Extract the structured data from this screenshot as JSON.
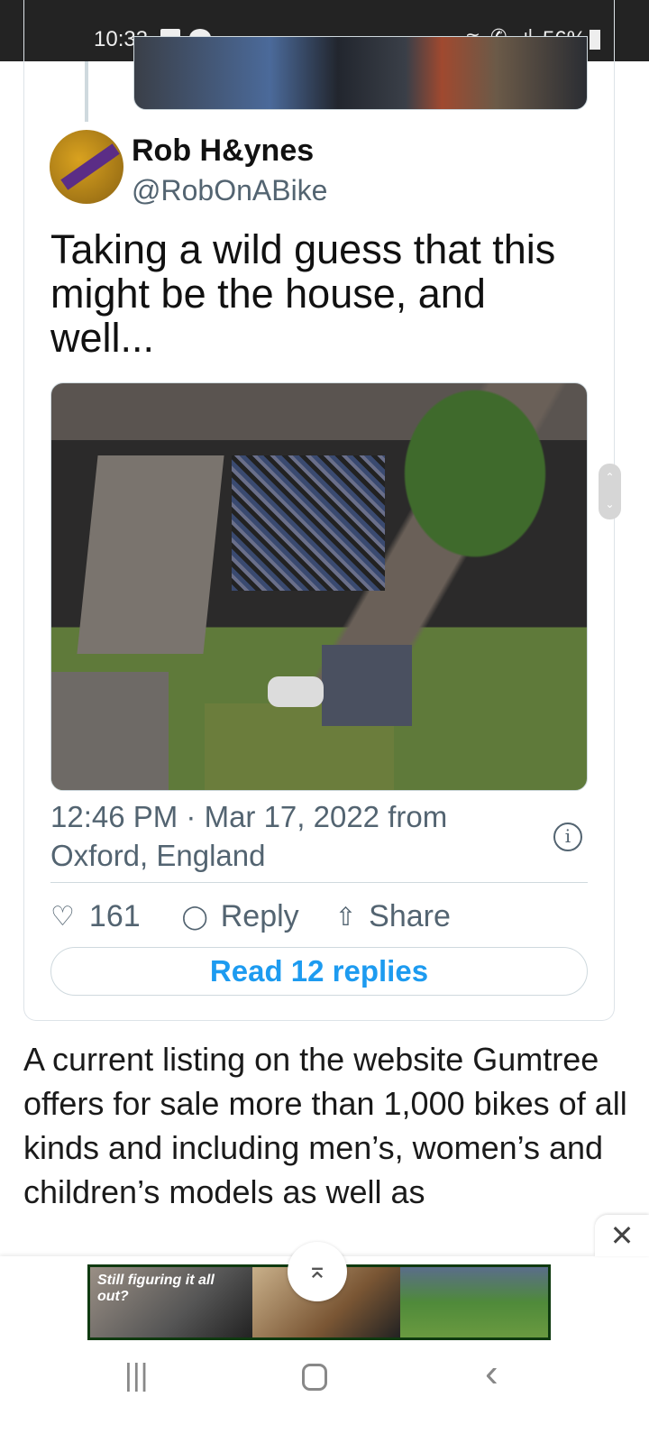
{
  "status_bar": {
    "time": "10:33",
    "battery": "56%",
    "icons": [
      "gallery-icon",
      "chat-bubble-icon",
      "wifi-icon",
      "wifi-calling-icon",
      "signal-icon",
      "battery-icon"
    ]
  },
  "tweet": {
    "author_name": "Rob H&ynes",
    "author_handle": "@RobOnABike",
    "text": "Taking a wild guess that this might be the house, and well...",
    "timestamp": "12:46 PM · Mar 17, 2022 from Oxford, England",
    "likes": "161",
    "reply_label": "Reply",
    "share_label": "Share",
    "read_replies_label": "Read 12 replies",
    "accent_color": "#1d9bf0"
  },
  "article": {
    "paragraph": "A current listing on the website Gumtree offers for sale more than 1,000 bikes of all kinds and including men’s, women’s and children’s models as well as"
  },
  "ad": {
    "text": "Still figuring it all out?"
  },
  "nav": {
    "recents": "|||",
    "home": "○",
    "back": "‹"
  }
}
